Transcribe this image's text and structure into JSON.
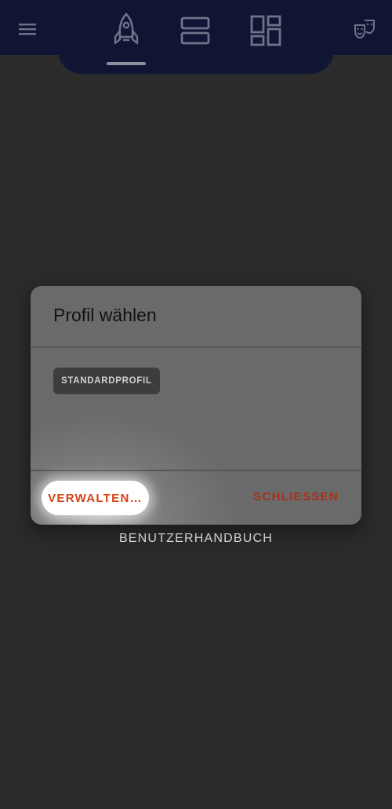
{
  "header": {
    "icons": [
      "menu-icon",
      "rocket-icon",
      "list-view-icon",
      "dashboard-icon",
      "theater-masks-icon"
    ],
    "active_tab": "rocket-icon"
  },
  "background": {
    "manual_link": "BENUTZERHANDBUCH"
  },
  "dialog": {
    "title": "Profil wählen",
    "profiles": [
      "STANDARDPROFIL"
    ],
    "manage_button": "VERWALTEN…",
    "close_button": "SCHLIESSEN"
  },
  "colors": {
    "header_bg": "#0f1533",
    "page_bg": "#2b2b2b",
    "dialog_bg": "#6a6a6a",
    "accent": "#d84315"
  }
}
